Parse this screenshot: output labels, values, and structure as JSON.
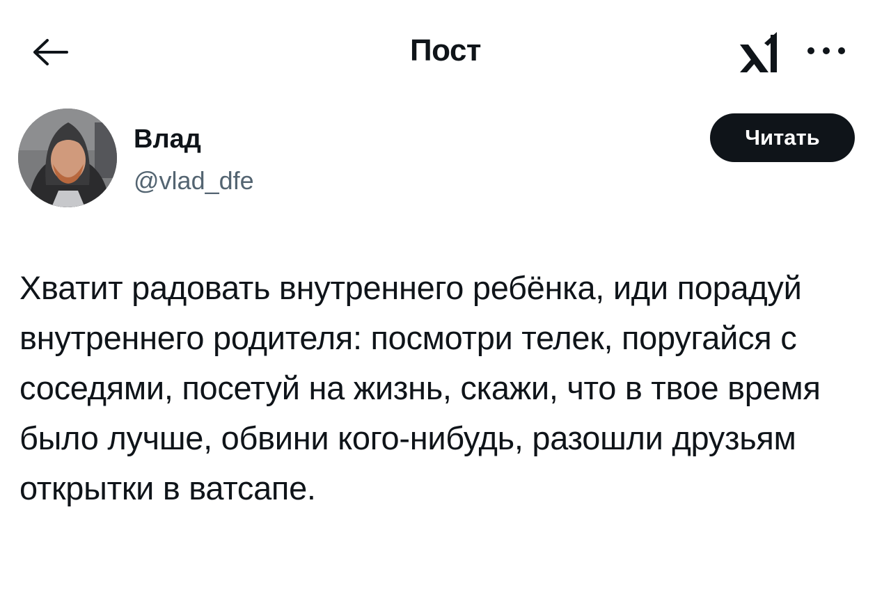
{
  "header": {
    "title": "Пост",
    "back_icon": "arrow-left-icon",
    "logo_icon": "x-logo-icon",
    "more_icon": "more-horizontal-icon"
  },
  "author": {
    "name": "Влад",
    "handle": "@vlad_dfe",
    "avatar_icon": "user-avatar"
  },
  "follow_button": {
    "label": "Читать",
    "background": "#0f1419",
    "text_color": "#ffffff"
  },
  "post": {
    "text": "Хватит радовать внутреннего ребёнка, иди порадуй внутреннего родителя: посмотри телек, поругайся с соседями, посетуй на жизнь, скажи, что в твое время было лучше, обвини кого-нибудь, разошли друзьям открытки в ватсапе."
  },
  "colors": {
    "text_primary": "#0f1419",
    "text_secondary": "#536471",
    "background": "#ffffff"
  }
}
